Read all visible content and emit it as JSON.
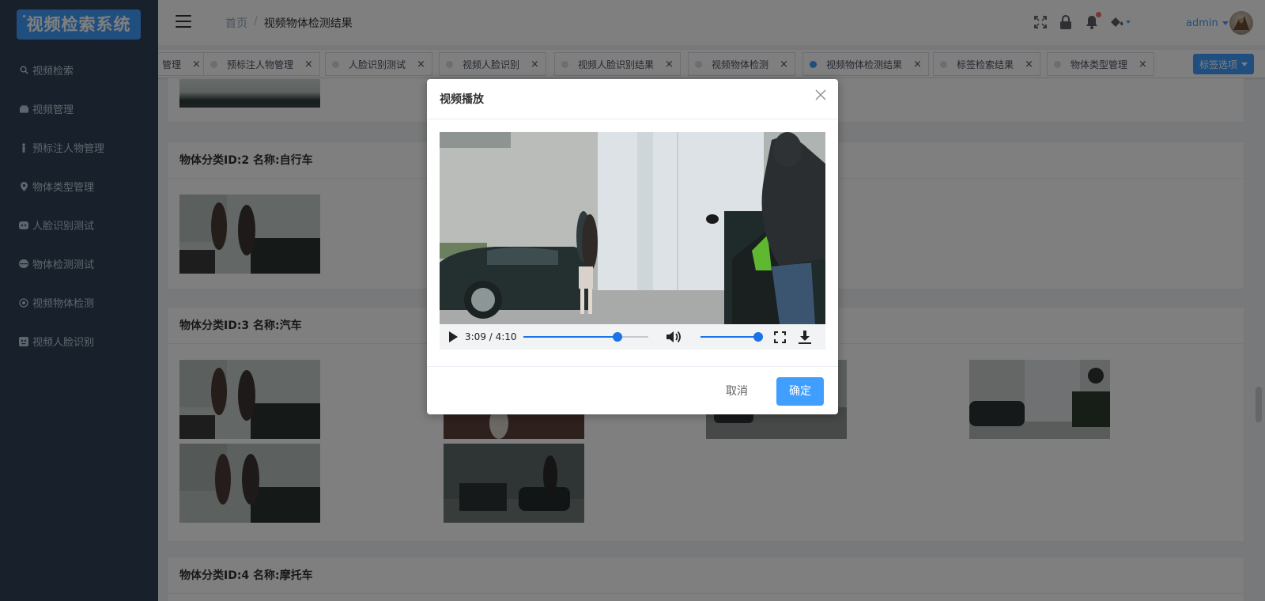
{
  "app": {
    "logo_text": "视频检索系统"
  },
  "sidebar": {
    "items": [
      {
        "label": "视频检索",
        "icon": "search-icon"
      },
      {
        "label": "视频管理",
        "icon": "video-icon"
      },
      {
        "label": "预标注人物管理",
        "icon": "person-icon"
      },
      {
        "label": "物体类型管理",
        "icon": "tag-icon"
      },
      {
        "label": "人脸识别测试",
        "icon": "face-icon"
      },
      {
        "label": "物体检测测试",
        "icon": "detect-icon"
      },
      {
        "label": "视频物体检测",
        "icon": "target-icon"
      },
      {
        "label": "视频人脸识别",
        "icon": "face-scan-icon"
      }
    ]
  },
  "header": {
    "breadcrumb_home": "首页",
    "breadcrumb_separator": "/",
    "breadcrumb_current": "视频物体检测结果",
    "user_name": "admin"
  },
  "tags": {
    "items": [
      {
        "label": "管理"
      },
      {
        "label": "预标注人物管理"
      },
      {
        "label": "人脸识别测试"
      },
      {
        "label": "视频人脸识别"
      },
      {
        "label": "视频人脸识别结果"
      },
      {
        "label": "视频物体检测"
      },
      {
        "label": "视频物体检测结果",
        "active": true
      },
      {
        "label": "标签检索结果"
      },
      {
        "label": "物体类型管理"
      }
    ],
    "options_label": "标签选项"
  },
  "sections": [
    {
      "title": "物体分类ID:2  名称:自行车"
    },
    {
      "title": "物体分类ID:3  名称:汽车"
    },
    {
      "title": "物体分类ID:4  名称:摩托车"
    }
  ],
  "dialog": {
    "title": "视频播放",
    "time_display": "3:09 / 4:10",
    "progress": 0.756,
    "volume": 1.0,
    "cancel_label": "取消",
    "confirm_label": "确定"
  },
  "colors": {
    "primary": "#409eff",
    "sidebar_bg": "#304156",
    "sidebar_text": "#bfcbd9"
  }
}
